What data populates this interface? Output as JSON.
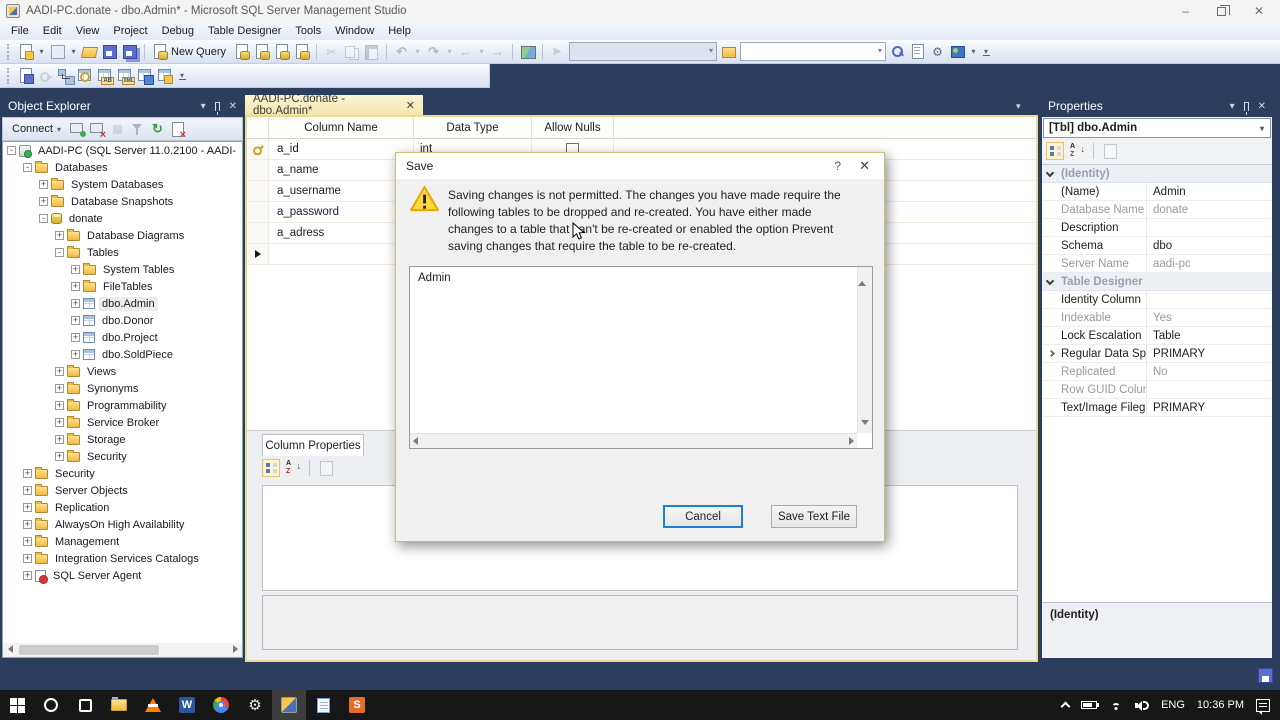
{
  "titlebar": {
    "title": "AADI-PC.donate - dbo.Admin* - Microsoft SQL Server Management Studio"
  },
  "menu": {
    "items": [
      "File",
      "Edit",
      "View",
      "Project",
      "Debug",
      "Table Designer",
      "Tools",
      "Window",
      "Help"
    ]
  },
  "toolbar_main": {
    "new_query_label": "New Query",
    "left_icons": [
      "new-item",
      "dropdown",
      "add-snippet",
      "dropdown",
      "open-file",
      "save",
      "save-all"
    ],
    "query_icons": [
      "new-database-engine-query",
      "new-mdx-query",
      "new-dmx-query",
      "new-xmla-query"
    ],
    "edit_icons": [
      "!cut",
      "!copy",
      "!paste"
    ],
    "undo_icons": [
      "!undo",
      "!dropdown",
      "!redo",
      "!dropdown",
      "!navigate-back",
      "!dropdown",
      "!navigate-fwd"
    ],
    "misc_icons": [
      "image-editor"
    ],
    "right_icons": [
      "search-database",
      "object-properties",
      "tools",
      "view-slides",
      "dropdown"
    ]
  },
  "toolbar_designer": {
    "icons": [
      "generate-change-script",
      "!primary-key",
      "relationships",
      "manage-indexes-keys",
      "manage-fulltext-index",
      "manage-xml-indexes",
      "table-view",
      "manage-check-constraints",
      "overflow"
    ]
  },
  "object_explorer": {
    "title": "Object Explorer",
    "connect_label": "Connect",
    "toolbar_icons": [
      "connect-object",
      "disconnect-object",
      "!stop",
      "filter",
      "refresh",
      "error-log"
    ],
    "tree": [
      {
        "label": "AADI-PC (SQL Server 11.0.2100 - AADI-",
        "depth": 0,
        "expander": "-",
        "icon": "server-icon"
      },
      {
        "label": "Databases",
        "depth": 1,
        "expander": "-",
        "icon": "folder-icon"
      },
      {
        "label": "System Databases",
        "depth": 2,
        "expander": "+",
        "icon": "folder-icon"
      },
      {
        "label": "Database Snapshots",
        "depth": 2,
        "expander": "+",
        "icon": "folder-icon"
      },
      {
        "label": "donate",
        "depth": 2,
        "expander": "-",
        "icon": "database-icon"
      },
      {
        "label": "Database Diagrams",
        "depth": 3,
        "expander": "+",
        "icon": "folder-icon"
      },
      {
        "label": "Tables",
        "depth": 3,
        "expander": "-",
        "icon": "folder-icon"
      },
      {
        "label": "System Tables",
        "depth": 4,
        "expander": "+",
        "icon": "folder-icon"
      },
      {
        "label": "FileTables",
        "depth": 4,
        "expander": "+",
        "icon": "folder-icon"
      },
      {
        "label": "dbo.Admin",
        "depth": 4,
        "expander": "+",
        "icon": "table-icon",
        "selected": true
      },
      {
        "label": "dbo.Donor",
        "depth": 4,
        "expander": "+",
        "icon": "table-icon"
      },
      {
        "label": "dbo.Project",
        "depth": 4,
        "expander": "+",
        "icon": "table-icon"
      },
      {
        "label": "dbo.SoldPiece",
        "depth": 4,
        "expander": "+",
        "icon": "table-icon"
      },
      {
        "label": "Views",
        "depth": 3,
        "expander": "+",
        "icon": "folder-icon"
      },
      {
        "label": "Synonyms",
        "depth": 3,
        "expander": "+",
        "icon": "folder-icon"
      },
      {
        "label": "Programmability",
        "depth": 3,
        "expander": "+",
        "icon": "folder-icon"
      },
      {
        "label": "Service Broker",
        "depth": 3,
        "expander": "+",
        "icon": "folder-icon"
      },
      {
        "label": "Storage",
        "depth": 3,
        "expander": "+",
        "icon": "folder-icon"
      },
      {
        "label": "Security",
        "depth": 3,
        "expander": "+",
        "icon": "folder-icon"
      },
      {
        "label": "Security",
        "depth": 1,
        "expander": "+",
        "icon": "folder-icon"
      },
      {
        "label": "Server Objects",
        "depth": 1,
        "expander": "+",
        "icon": "folder-icon"
      },
      {
        "label": "Replication",
        "depth": 1,
        "expander": "+",
        "icon": "folder-icon"
      },
      {
        "label": "AlwaysOn High Availability",
        "depth": 1,
        "expander": "+",
        "icon": "folder-icon"
      },
      {
        "label": "Management",
        "depth": 1,
        "expander": "+",
        "icon": "folder-icon"
      },
      {
        "label": "Integration Services Catalogs",
        "depth": 1,
        "expander": "+",
        "icon": "folder-icon"
      },
      {
        "label": "SQL Server Agent",
        "depth": 1,
        "expander": "+",
        "icon": "agent-icon"
      }
    ]
  },
  "document": {
    "tab_title": "AADI-PC.donate - dbo.Admin*",
    "grid": {
      "headers": [
        "Column Name",
        "Data Type",
        "Allow Nulls"
      ],
      "rows": [
        {
          "column_name": "a_id",
          "data_type": "int",
          "primary_key": true,
          "show_checkbox": true
        },
        {
          "column_name": "a_name",
          "data_type": ""
        },
        {
          "column_name": "a_username",
          "data_type": ""
        },
        {
          "column_name": "a_password",
          "data_type": ""
        },
        {
          "column_name": "a_adress",
          "data_type": ""
        }
      ]
    },
    "column_properties_label": "Column Properties"
  },
  "dialog": {
    "title": "Save",
    "help_label": "?",
    "close_label": "✕",
    "message": "Saving changes is not permitted. The changes you have made require the following tables to be dropped and re-created. You have either made changes to a table that can't be re-created or enabled the option Prevent saving changes that require the table to be re-created.",
    "list_item": "Admin",
    "cancel_label": "Cancel",
    "save_label": "Save Text File"
  },
  "properties": {
    "title": "Properties",
    "selector": "[Tbl] dbo.Admin",
    "groups": [
      {
        "label": "(Identity)",
        "rows": [
          {
            "key": "(Name)",
            "value": "Admin"
          },
          {
            "key": "Database Name",
            "value": "donate",
            "readonly": true
          },
          {
            "key": "Description",
            "value": ""
          },
          {
            "key": "Schema",
            "value": "dbo"
          },
          {
            "key": "Server Name",
            "value": "aadi-pc",
            "readonly": true
          }
        ]
      },
      {
        "label": "Table Designer",
        "rows": [
          {
            "key": "Identity Column",
            "value": ""
          },
          {
            "key": "Indexable",
            "value": "Yes",
            "readonly": true
          },
          {
            "key": "Lock Escalation",
            "value": "Table"
          },
          {
            "key": "Regular Data Spac",
            "value": "PRIMARY",
            "expandable": true
          },
          {
            "key": "Replicated",
            "value": "No",
            "readonly": true
          },
          {
            "key": "Row GUID Colum",
            "value": "",
            "readonly": true
          },
          {
            "key": "Text/Image Filegr",
            "value": "PRIMARY"
          }
        ]
      }
    ],
    "description_title": "(Identity)"
  },
  "taskbar": {
    "icons": [
      "start",
      "cortana",
      "task-view",
      "file-explorer",
      "vlc",
      "word",
      "chrome",
      "settings",
      "ssms",
      "notepad",
      "sublime"
    ],
    "active_icon": "ssms",
    "tray": {
      "language": "ENG",
      "time": "10:36 PM"
    }
  }
}
